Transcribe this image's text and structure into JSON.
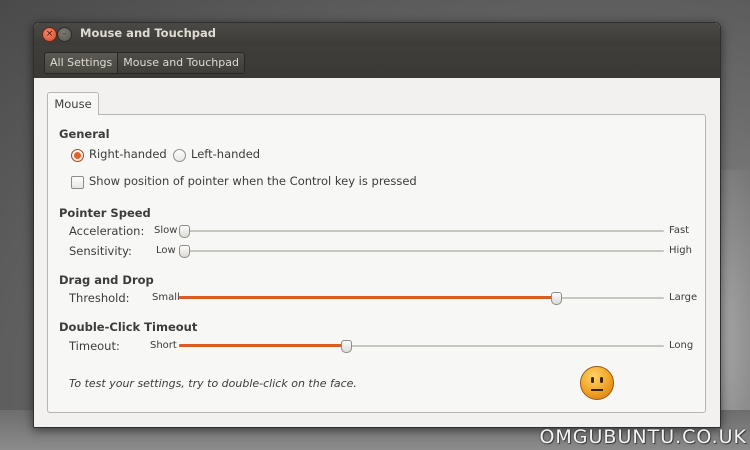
{
  "window": {
    "title": "Mouse and Touchpad"
  },
  "toolbar": {
    "breadcrumbs": [
      "All Settings",
      "Mouse and Touchpad"
    ]
  },
  "tab": {
    "label": "Mouse"
  },
  "general": {
    "heading": "General",
    "right_handed_label": "Right-handed",
    "left_handed_label": "Left-handed",
    "selected": "Right-handed",
    "show_pointer_label": "Show position of pointer when the Control key is pressed",
    "show_pointer_checked": false
  },
  "pointer_speed": {
    "heading": "Pointer Speed",
    "acceleration": {
      "label": "Acceleration:",
      "min_label": "Slow",
      "max_label": "Fast",
      "value_fraction": 0.0
    },
    "sensitivity": {
      "label": "Sensitivity:",
      "min_label": "Low",
      "max_label": "High",
      "value_fraction": 0.0
    }
  },
  "drag_and_drop": {
    "heading": "Drag and Drop",
    "threshold": {
      "label": "Threshold:",
      "min_label": "Small",
      "max_label": "Large",
      "value_fraction": 0.78
    }
  },
  "double_click": {
    "heading": "Double-Click Timeout",
    "timeout": {
      "label": "Timeout:",
      "min_label": "Short",
      "max_label": "Long",
      "value_fraction": 0.34
    },
    "test_note": "To test your settings, try to double-click on the face."
  },
  "watermark": "OMGUBUNTU.CO.UK",
  "colors": {
    "accent": "#d85d25",
    "titlebar": "#3c3b37",
    "window_bg": "#f2f1f0"
  }
}
